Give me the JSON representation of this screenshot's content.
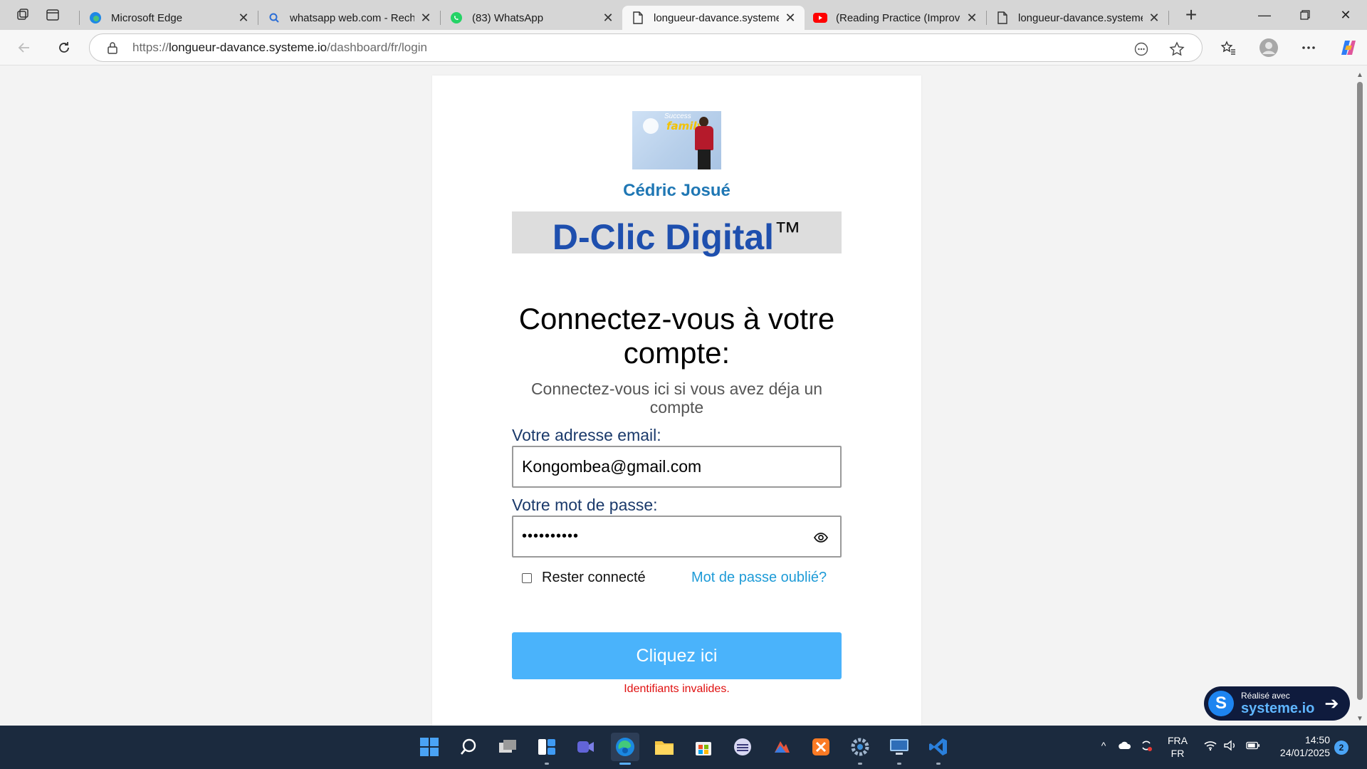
{
  "browser": {
    "tabs": [
      {
        "label": "Microsoft Edge",
        "icon": "edge-icon",
        "active": false
      },
      {
        "label": "whatsapp web.com - Recherche",
        "icon": "search-icon",
        "active": false
      },
      {
        "label": "(83) WhatsApp",
        "icon": "whatsapp-icon",
        "active": false
      },
      {
        "label": "longueur-davance.systeme.io",
        "icon": "page-icon",
        "active": true
      },
      {
        "label": "(Reading Practice (Improve",
        "icon": "youtube-icon",
        "active": false
      },
      {
        "label": "longueur-davance.systeme.io",
        "icon": "page-icon",
        "active": false
      }
    ],
    "url_scheme": "https://",
    "url_host": "longueur-davance.systeme.io",
    "url_path": "/dashboard/fr/login"
  },
  "page": {
    "author_name": "Cédric Josué",
    "logo_text_top": "Success",
    "logo_text_main": "family",
    "brand_name": "D-Clic Digital",
    "brand_tm": "™",
    "heading": "Connectez-vous à votre compte:",
    "subheading": "Connectez-vous ici si vous avez déja un compte",
    "email_label": "Votre adresse email:",
    "email_value": "Kongombea@gmail.com",
    "password_label": "Votre mot de passe:",
    "password_value": "••••••••••",
    "remember_label": "Rester connecté",
    "forgot_label": "Mot de passe oublié?",
    "submit_label": "Cliquez ici",
    "error_message": "Identifiants invalides.",
    "badge_small": "Réalisé avec",
    "badge_big": "systeme.io",
    "badge_logo": "S"
  },
  "taskbar": {
    "apps": [
      "start-icon",
      "search-icon",
      "task-view-icon",
      "widgets-icon",
      "teams-icon",
      "edge-icon",
      "file-explorer-icon",
      "store-icon",
      "app-icon",
      "app-icon",
      "xampp-icon",
      "settings-icon",
      "remote-desktop-icon",
      "visual-studio-icon"
    ],
    "lang_top": "FRA",
    "lang_bottom": "FR",
    "time": "14:50",
    "date": "24/01/2025",
    "notification_count": "2"
  },
  "colors": {
    "brand_blue": "#1e4fae",
    "author_blue": "#1f77b4",
    "button_blue": "#4ab3fb",
    "link_blue": "#1e9bd7",
    "error_red": "#e01010"
  }
}
